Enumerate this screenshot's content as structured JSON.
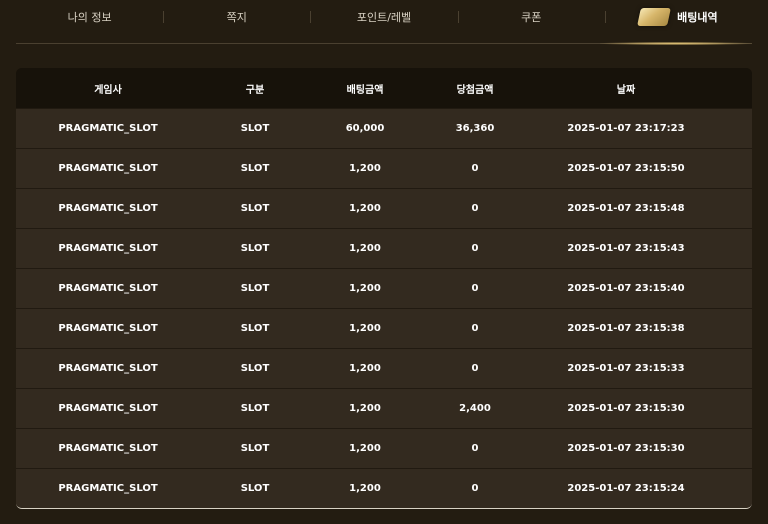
{
  "tabs": [
    {
      "label": "나의 정보",
      "active": false
    },
    {
      "label": "쪽지",
      "active": false
    },
    {
      "label": "포인트/레벨",
      "active": false
    },
    {
      "label": "쿠폰",
      "active": false
    },
    {
      "label": "배팅내역",
      "active": true,
      "icon": "coupon-ticket-icon"
    }
  ],
  "table": {
    "headers": [
      "게임사",
      "구분",
      "배팅금액",
      "당첨금액",
      "날짜"
    ],
    "rows": [
      [
        "PRAGMATIC_SLOT",
        "SLOT",
        "60,000",
        "36,360",
        "2025-01-07 23:17:23"
      ],
      [
        "PRAGMATIC_SLOT",
        "SLOT",
        "1,200",
        "0",
        "2025-01-07 23:15:50"
      ],
      [
        "PRAGMATIC_SLOT",
        "SLOT",
        "1,200",
        "0",
        "2025-01-07 23:15:48"
      ],
      [
        "PRAGMATIC_SLOT",
        "SLOT",
        "1,200",
        "0",
        "2025-01-07 23:15:43"
      ],
      [
        "PRAGMATIC_SLOT",
        "SLOT",
        "1,200",
        "0",
        "2025-01-07 23:15:40"
      ],
      [
        "PRAGMATIC_SLOT",
        "SLOT",
        "1,200",
        "0",
        "2025-01-07 23:15:38"
      ],
      [
        "PRAGMATIC_SLOT",
        "SLOT",
        "1,200",
        "0",
        "2025-01-07 23:15:33"
      ],
      [
        "PRAGMATIC_SLOT",
        "SLOT",
        "1,200",
        "2,400",
        "2025-01-07 23:15:30"
      ],
      [
        "PRAGMATIC_SLOT",
        "SLOT",
        "1,200",
        "0",
        "2025-01-07 23:15:30"
      ],
      [
        "PRAGMATIC_SLOT",
        "SLOT",
        "1,200",
        "0",
        "2025-01-07 23:15:24"
      ]
    ]
  },
  "colors": {
    "background": "#231c11",
    "row": "#332a1f",
    "header": "#17120a",
    "accent_gold": "#d7b66a"
  }
}
